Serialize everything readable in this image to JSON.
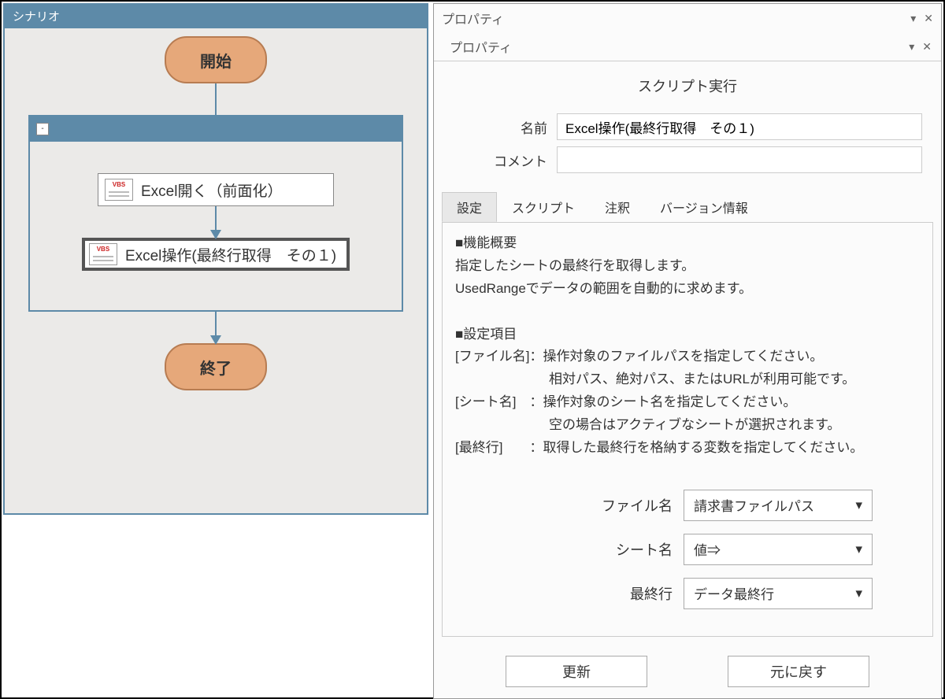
{
  "scenario": {
    "title": "シナリオ",
    "start_label": "開始",
    "end_label": "終了",
    "group_collapse": "-",
    "vbs_badge": "VBS",
    "step1_label": "Excel開く（前面化）",
    "step2_label": "Excel操作(最終行取得　その１)"
  },
  "properties": {
    "outer_title": "プロパティ",
    "inner_title": "プロパティ",
    "section_title": "スクリプト実行",
    "name_label": "名前",
    "name_value": "Excel操作(最終行取得　その１)",
    "comment_label": "コメント",
    "comment_value": "",
    "tabs": {
      "setting": "設定",
      "script": "スクリプト",
      "annotation": "注釈",
      "version": "バージョン情報"
    },
    "description": "■機能概要\n指定したシートの最終行を取得します。\nUsedRangeでデータの範囲を自動的に求めます。\n\n■設定項目\n[ファイル名]：操作対象のファイルパスを指定してください。\n　　　　　　　相対パス、絶対パス、またはURLが利用可能です。\n[シート名]　：操作対象のシート名を指定してください。\n　　　　　　　空の場合はアクティブなシートが選択されます。\n[最終行]　　：取得した最終行を格納する変数を指定してください。",
    "params": {
      "file_label": "ファイル名",
      "file_value": "請求書ファイルパス",
      "sheet_label": "シート名",
      "sheet_value": "値⇒",
      "lastrow_label": "最終行",
      "lastrow_value": "データ最終行"
    },
    "buttons": {
      "update": "更新",
      "revert": "元に戻す"
    }
  }
}
